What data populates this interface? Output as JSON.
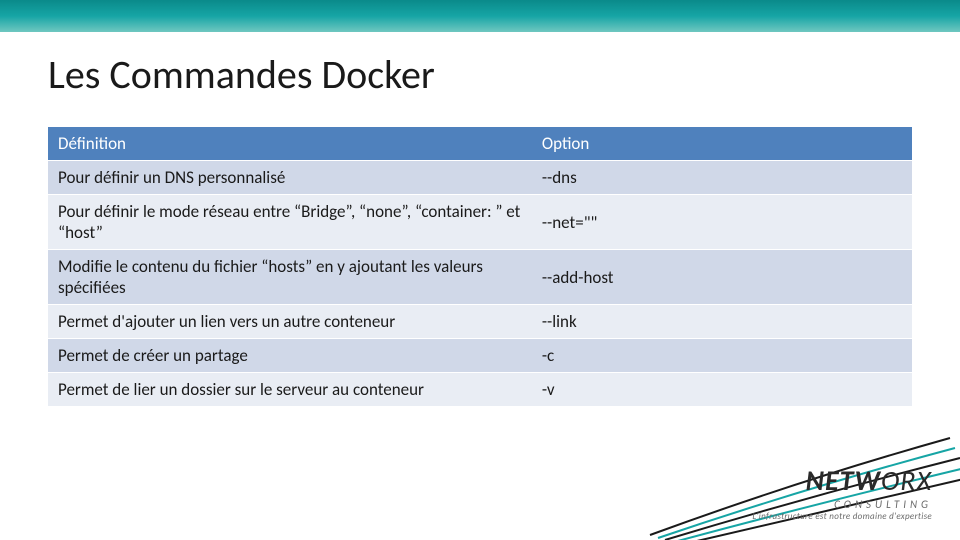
{
  "title": "Les Commandes Docker",
  "headers": {
    "col1": "Définition",
    "col2": "Option"
  },
  "rows": [
    {
      "def": "Pour définir un DNS personnalisé",
      "opt": "--dns"
    },
    {
      "def": "Pour définir le mode réseau entre “Bridge”, “none”, “container: ” et “host”",
      "opt": "--net=\"\""
    },
    {
      "def": "Modifie le contenu du fichier “hosts” en y ajoutant les valeurs spécifiées",
      "opt": "--add-host"
    },
    {
      "def": "Permet d'ajouter un lien vers un autre conteneur",
      "opt": "--link"
    },
    {
      "def": "Permet de créer un partage",
      "opt": "-c"
    },
    {
      "def": "Permet de lier un dossier sur le serveur au conteneur",
      "opt": "-v"
    }
  ],
  "logo": {
    "brand1": "NETW",
    "brand2": "ORX",
    "sub": "CONSULTING",
    "tagline": "L'infrastructure est notre domaine d'expertise"
  }
}
